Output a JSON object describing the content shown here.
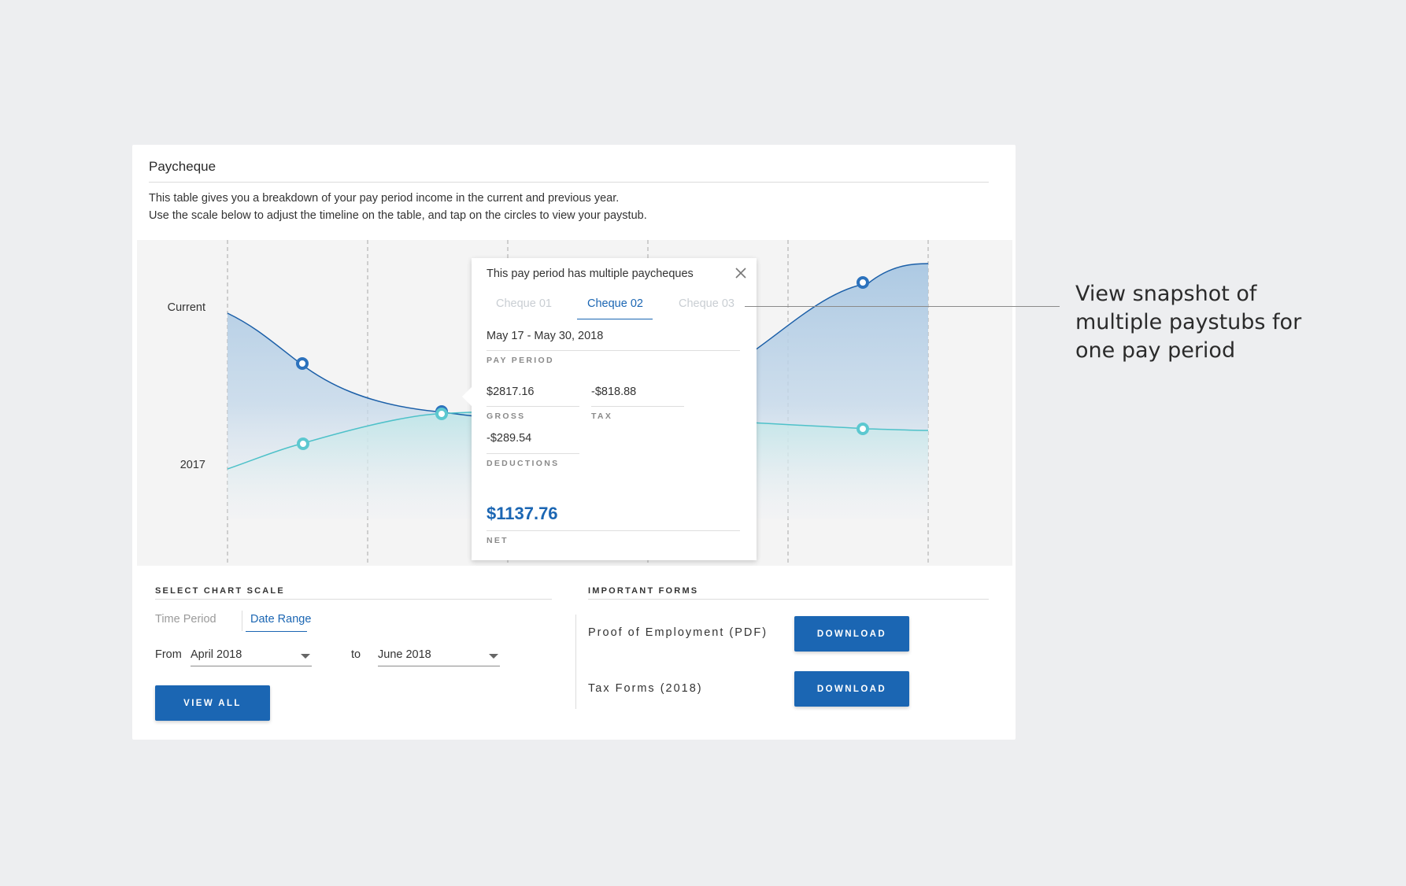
{
  "card": {
    "title": "Paycheque",
    "description_line1": "This table gives you a breakdown of your pay period income in the current and previous year.",
    "description_line2": "Use the scale below to adjust the timeline on the table, and tap on the circles to view your paystub."
  },
  "chart": {
    "series_labels": {
      "current": "Current",
      "previous": "2017"
    },
    "colors": {
      "current_line": "#1b5fa8",
      "current_fill": "#a9c7e2",
      "previous_line": "#4ec1c9",
      "previous_fill": "#bfe6e8"
    }
  },
  "popup": {
    "heading": "This pay period has multiple paycheques",
    "tabs": [
      "Cheque 01",
      "Cheque 02",
      "Cheque 03"
    ],
    "active_tab": "Cheque 02",
    "pay_period_value": "May 17 - May 30, 2018",
    "pay_period_label": "PAY PERIOD",
    "gross_value": "$2817.16",
    "gross_label": "GROSS",
    "tax_value": "-$818.88",
    "tax_label": "TAX",
    "deductions_value": "-$289.54",
    "deductions_label": "DEDUCTIONS",
    "net_value": "$1137.76",
    "net_label": "NET",
    "close_icon": "close-icon"
  },
  "scale": {
    "label": "SELECT CHART SCALE",
    "tabs": [
      "Time Period",
      "Date Range"
    ],
    "active_tab": "Date Range",
    "from_label": "From",
    "from_value": "April 2018",
    "to_label": "to",
    "to_value": "June 2018",
    "view_all_label": "VIEW ALL"
  },
  "forms": {
    "label": "IMPORTANT FORMS",
    "items": [
      {
        "name": "Proof of Employment (PDF)",
        "button": "DOWNLOAD"
      },
      {
        "name": "Tax Forms (2018)",
        "button": "DOWNLOAD"
      }
    ]
  },
  "annotation": {
    "text": "View snapshot of multiple paystubs for one pay period"
  }
}
